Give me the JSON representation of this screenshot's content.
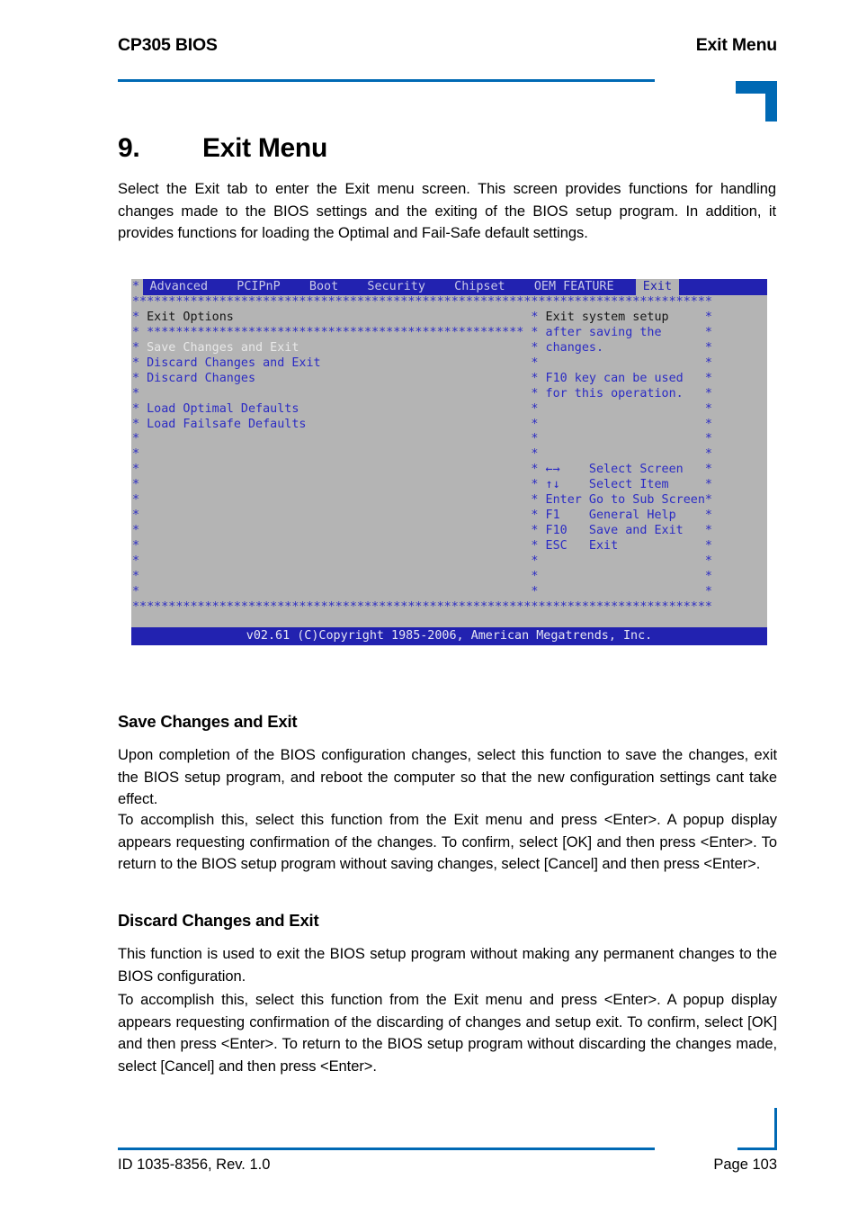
{
  "header": {
    "left_title": "CP305 BIOS",
    "right_title": "Exit Menu",
    "accent_color": "#0069B4"
  },
  "chapter": {
    "number": "9.",
    "title": "Exit Menu",
    "intro": "Select the Exit tab to enter the Exit menu screen. This screen provides functions for handling changes made to the BIOS settings and the exiting of the BIOS setup program. In addition, it provides functions for loading the Optimal and Fail-Safe default settings."
  },
  "bios_screen": {
    "tabs": [
      "Advanced",
      "PCIPnP",
      "Boot",
      "Security",
      "Chipset",
      "OEM FEATURE",
      "Exit"
    ],
    "active_tab": "Exit",
    "tab_row_text": " Advanced    PCIPnP    Boot    Security    Chipset    OEM FEATURE   ",
    "active_tab_text": " Exit ",
    "panel_title": "Exit Options",
    "menu_items": [
      "Save Changes and Exit",
      "Discard Changes and Exit",
      "Discard Changes",
      "",
      "Load Optimal Defaults",
      "Load Failsafe Defaults"
    ],
    "selected_item": "Save Changes and Exit",
    "help_lines": [
      "Exit system setup",
      "after saving the",
      "changes.",
      "",
      "F10 key can be used",
      "for this operation."
    ],
    "key_legend": [
      {
        "key": "←→",
        "action": "Select Screen"
      },
      {
        "key": "↑↓",
        "action": "Select Item"
      },
      {
        "key": "Enter",
        "action": "Go to Sub Screen"
      },
      {
        "key": "F1",
        "action": "General Help"
      },
      {
        "key": "F10",
        "action": "Save and Exit"
      },
      {
        "key": "ESC",
        "action": "Exit"
      }
    ],
    "status_bar": "v02.61 (C)Copyright 1985-2006, American Megatrends, Inc.",
    "colors": {
      "background": "#b4b4b4",
      "text": "#2b2bc4",
      "bar": "#2222b0",
      "highlight_text": "#e8e8e8"
    }
  },
  "sections": [
    {
      "heading": "Save Changes and Exit",
      "paragraphs": [
        "Upon completion of the BIOS configuration changes, select this function to save the changes, exit the BIOS setup program, and reboot the computer so that the new configuration settings cant take effect.",
        "To accomplish this, select this function from the Exit menu and press <Enter>. A popup display appears requesting confirmation of the changes. To confirm, select [OK] and then press <Enter>. To return to the BIOS setup program without saving changes, select [Cancel] and then press <Enter>."
      ]
    },
    {
      "heading": "Discard Changes and Exit",
      "paragraphs": [
        "This function is used to exit the BIOS setup program without making any permanent changes to the BIOS configuration.",
        "To accomplish this, select this function from the Exit menu and press <Enter>. A popup display appears requesting confirmation of the discarding of changes and setup exit. To confirm, select [OK] and then press <Enter>. To return to the BIOS setup program without discarding the changes made, select [Cancel] and then press <Enter>."
      ]
    }
  ],
  "footer": {
    "document_id": "ID 1035-8356, Rev. 1.0",
    "page_label": "Page 103"
  }
}
